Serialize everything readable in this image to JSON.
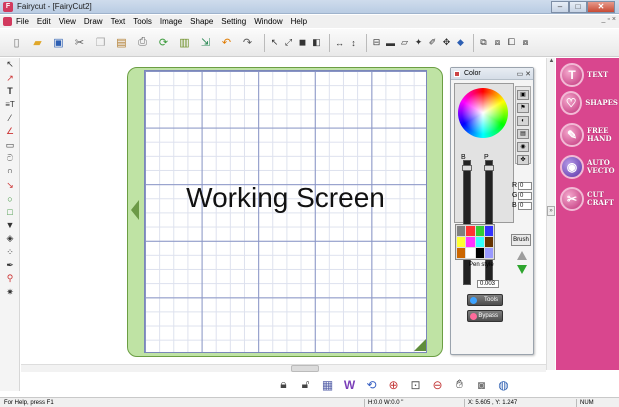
{
  "window": {
    "title": "Fairycut - [FairyCut2]",
    "controls": [
      "–",
      "□",
      "✕"
    ]
  },
  "menu": [
    "File",
    "Edit",
    "View",
    "Draw",
    "Text",
    "Tools",
    "Image",
    "Shape",
    "Setting",
    "Window",
    "Help"
  ],
  "toolbar": {
    "icons": [
      "new-file-icon",
      "open-folder-icon",
      "save-icon",
      "cut-icon",
      "copy-icon",
      "paste-icon",
      "print-icon",
      "refresh-icon",
      "book-icon",
      "export-icon",
      "undo-icon",
      "redo-icon",
      "pointer-icon",
      "node-icon",
      "fill-icon",
      "weld-icon",
      "flip-h-icon",
      "flip-v-icon",
      "align-icon",
      "eraser-icon",
      "knife-icon",
      "rotate-icon",
      "group-icon",
      "ungroup-icon",
      "stamp-icon",
      "copy-page-icon",
      "tile-icon"
    ]
  },
  "left_tools": [
    "select-icon",
    "node-edit-icon",
    "text-icon",
    "text-frame-icon",
    "pen-icon",
    "line-icon",
    "dimension-icon",
    "spiral-icon",
    "spiral2-icon",
    "bezier-icon",
    "ellipse-icon",
    "rectangle-icon",
    "paint-bucket-icon",
    "shapes-icon",
    "dots-icon",
    "dropper-icon",
    "transform-icon",
    "magic-icon"
  ],
  "canvas": {
    "working_label": "Working Screen"
  },
  "color_panel": {
    "title": "Color",
    "channel_labels": [
      "R",
      "G",
      "B"
    ],
    "channel_values": [
      "0",
      "0",
      "0"
    ],
    "slider_labels": [
      "B",
      "P"
    ],
    "brush_label": "Brush",
    "pen_style_label": "Pen style",
    "pen_width": "0.003",
    "tools_label": "Tools",
    "bypass_label": "Bypass",
    "swatch_colors": [
      "#808080",
      "#ff3333",
      "#33cc33",
      "#3333ff",
      "#ffff33",
      "#ff33ff",
      "#33ffff",
      "#663300",
      "#cc6600",
      "#ffffff",
      "#000000",
      "#9999ff"
    ]
  },
  "right_panel": {
    "items": [
      {
        "label": "TEXT",
        "glyph": "T"
      },
      {
        "label": "SHAPES",
        "glyph": "♡"
      },
      {
        "label": "FREE HAND",
        "glyph": "✎"
      },
      {
        "label": "AUTO VECTO",
        "glyph": "◉"
      },
      {
        "label": "CUT CRAFT",
        "glyph": "✂"
      }
    ],
    "accent": "#d9468e"
  },
  "bottom_icons": [
    "lock-icon",
    "unlock-icon",
    "grid-icon",
    "weld-icon",
    "convert-icon",
    "zoom-in-icon",
    "zoom-select-icon",
    "zoom-out-icon",
    "pan-icon",
    "preview-icon",
    "globe-icon"
  ],
  "status": {
    "help": "For Help, press F1",
    "hw": "H:0.0  W:0.0 \"",
    "xy": "X: 5.605 , Y: 1.247",
    "num": "NUM"
  }
}
